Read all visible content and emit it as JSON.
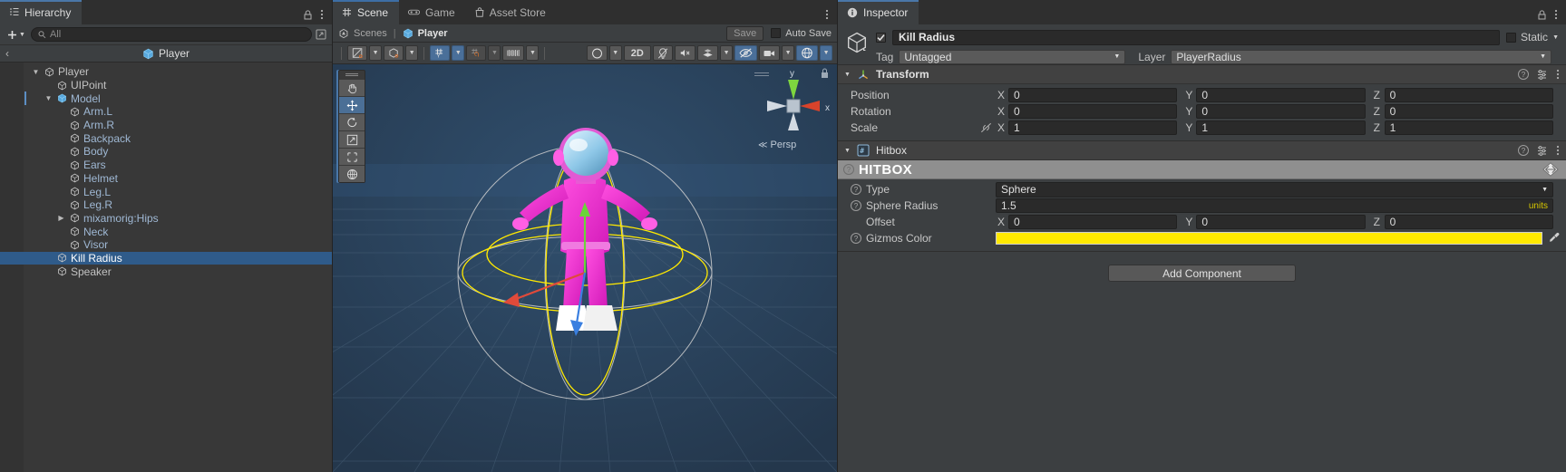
{
  "hierarchy": {
    "tab_label": "Hierarchy",
    "add_label": "+",
    "search_placeholder": "All",
    "breadcrumb": {
      "back": "‹",
      "label": "Player"
    },
    "items": [
      {
        "label": "Player",
        "depth": 0,
        "twirl": "down",
        "child": false,
        "selected": false
      },
      {
        "label": "UIPoint",
        "depth": 1,
        "twirl": "none",
        "child": false,
        "selected": false
      },
      {
        "label": "Model",
        "depth": 1,
        "twirl": "down",
        "child": true,
        "selected": false,
        "prefab": true
      },
      {
        "label": "Arm.L",
        "depth": 2,
        "twirl": "none",
        "child": true,
        "selected": false
      },
      {
        "label": "Arm.R",
        "depth": 2,
        "twirl": "none",
        "child": true,
        "selected": false
      },
      {
        "label": "Backpack",
        "depth": 2,
        "twirl": "none",
        "child": true,
        "selected": false
      },
      {
        "label": "Body",
        "depth": 2,
        "twirl": "none",
        "child": true,
        "selected": false
      },
      {
        "label": "Ears",
        "depth": 2,
        "twirl": "none",
        "child": true,
        "selected": false
      },
      {
        "label": "Helmet",
        "depth": 2,
        "twirl": "none",
        "child": true,
        "selected": false
      },
      {
        "label": "Leg.L",
        "depth": 2,
        "twirl": "none",
        "child": true,
        "selected": false
      },
      {
        "label": "Leg.R",
        "depth": 2,
        "twirl": "none",
        "child": true,
        "selected": false
      },
      {
        "label": "mixamorig:Hips",
        "depth": 2,
        "twirl": "right",
        "child": true,
        "selected": false
      },
      {
        "label": "Neck",
        "depth": 2,
        "twirl": "none",
        "child": true,
        "selected": false
      },
      {
        "label": "Visor",
        "depth": 2,
        "twirl": "none",
        "child": true,
        "selected": false
      },
      {
        "label": "Kill Radius",
        "depth": 1,
        "twirl": "none",
        "child": false,
        "selected": true
      },
      {
        "label": "Speaker",
        "depth": 1,
        "twirl": "none",
        "child": false,
        "selected": false
      }
    ]
  },
  "scene": {
    "tabs": [
      {
        "label": "Scene",
        "icon": "grid-icon",
        "active": true
      },
      {
        "label": "Game",
        "icon": "gamepad-icon",
        "active": false
      },
      {
        "label": "Asset Store",
        "icon": "shoppingbag-icon",
        "active": false
      }
    ],
    "subbar": {
      "scenes_label": "Scenes",
      "separator": "|",
      "current_scene": "Player",
      "save_label": "Save",
      "autosave_label": "Auto Save"
    },
    "toolbar": {
      "pivot_mode": "Center",
      "pivot_rotation": "Global",
      "draw_mode": "Shaded",
      "two_d_label": "2D",
      "lighting": "lighting-icon",
      "audio": "audio-mute-icon",
      "fx": "effects-icon",
      "hidden": "visibility-off-icon",
      "camera": "camera-icon",
      "gizmos": "gizmos-icon"
    },
    "tools": [
      {
        "name": "hand-tool",
        "active": false
      },
      {
        "name": "move-tool",
        "active": true
      },
      {
        "name": "rotate-tool",
        "active": false
      },
      {
        "name": "scale-tool",
        "active": false
      },
      {
        "name": "rect-tool",
        "active": false
      },
      {
        "name": "transform-tool",
        "active": false
      }
    ],
    "viewport": {
      "persp_label": "Persp",
      "axis_x": "x",
      "axis_y": "y",
      "bg_color": "#2b3f56"
    }
  },
  "inspector": {
    "tab_label": "Inspector",
    "object": {
      "enabled": true,
      "name": "Kill Radius",
      "static_label": "Static",
      "tag_label": "Tag",
      "tag_value": "Untagged",
      "layer_label": "Layer",
      "layer_value": "PlayerRadius"
    },
    "transform": {
      "title": "Transform",
      "rows": [
        {
          "label": "Position",
          "x": "0",
          "y": "0",
          "z": "0",
          "link": false
        },
        {
          "label": "Rotation",
          "x": "0",
          "y": "0",
          "z": "0",
          "link": false
        },
        {
          "label": "Scale",
          "x": "1",
          "y": "1",
          "z": "1",
          "link": true
        }
      ],
      "axis_labels": {
        "x": "X",
        "y": "Y",
        "z": "Z"
      }
    },
    "hitbox": {
      "title": "Hitbox",
      "banner": "HITBOX",
      "type_label": "Type",
      "type_value": "Sphere",
      "radius_label": "Sphere Radius",
      "radius_value": "1.5",
      "radius_units": "units",
      "offset_label": "Offset",
      "offset": {
        "x": "0",
        "y": "0",
        "z": "0"
      },
      "gizmos_color_label": "Gizmos Color",
      "gizmos_color_value": "#ffe900"
    },
    "add_component_label": "Add Component"
  }
}
